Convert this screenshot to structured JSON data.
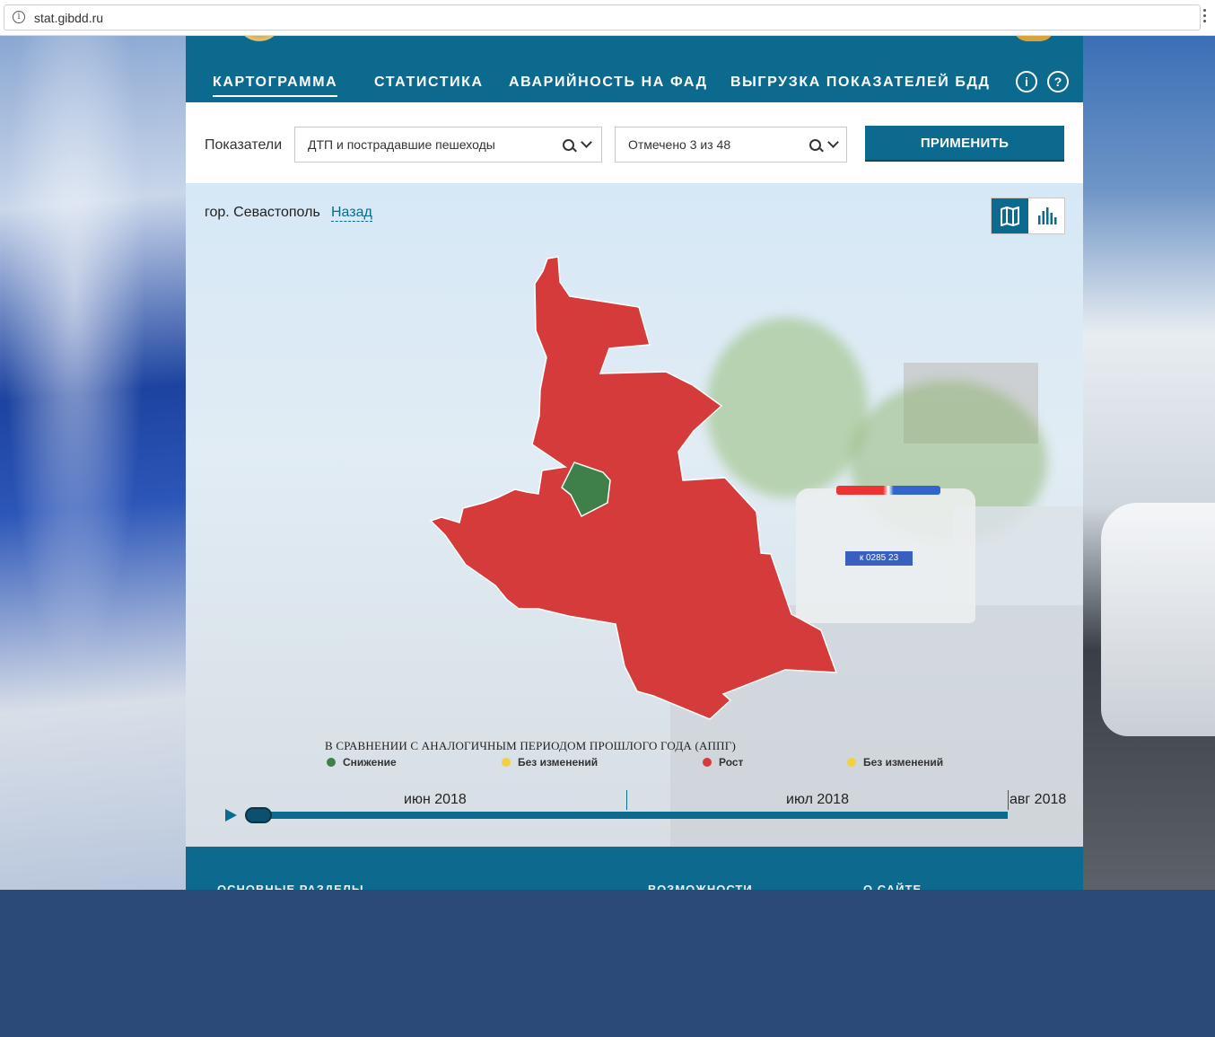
{
  "browser": {
    "url": "stat.gibdd.ru"
  },
  "nav": {
    "items": [
      {
        "label": "КАРТОГРАММА"
      },
      {
        "label": "СТАТИСТИКА"
      },
      {
        "label": "АВАРИЙНОСТЬ НА ФАД"
      },
      {
        "label": "ВЫГРУЗКА ПОКАЗАТЕЛЕЙ БДД"
      }
    ],
    "info_glyph": "i",
    "help_glyph": "?"
  },
  "filters": {
    "label": "Показатели",
    "indicator_value": "ДТП и пострадавшие пешеходы",
    "selected_value": "Отмечено 3 из 48",
    "apply_label": "ПРИМЕНИТЬ"
  },
  "map": {
    "location": "гор. Севастополь",
    "back_label": "Назад",
    "photo_plate": "к 0285 23",
    "regions": [
      {
        "name": "main-region",
        "status": "Рост",
        "color": "#d63b3b"
      },
      {
        "name": "small-region",
        "status": "Снижение",
        "color": "#3f7f4a"
      }
    ]
  },
  "legend": {
    "title": "В СРАВНЕНИИ С АНАЛОГИЧНЫМ ПЕРИОДОМ ПРОШЛОГО ГОДА (АППГ)",
    "items": [
      {
        "label": "Снижение",
        "color": "#3f7f4a"
      },
      {
        "label": "Без изменений",
        "color": "#f2d23c"
      },
      {
        "label": "Рост",
        "color": "#d63b3b"
      },
      {
        "label": "Без изменений",
        "color": "#f2d23c"
      }
    ]
  },
  "timeline": {
    "months": [
      "июн 2018",
      "июл 2018",
      "авг 2018"
    ]
  },
  "footer": {
    "headings": [
      "ОСНОВНЫЕ РАЗДЕЛЫ",
      "ВОЗМОЖНОСТИ",
      "О САЙТЕ"
    ]
  },
  "colors": {
    "brand": "#0c6a8e",
    "growth": "#d63b3b",
    "decrease": "#3f7f4a",
    "nochange": "#f2d23c"
  },
  "icons": [
    "info-icon",
    "search-icon",
    "chevron-down-icon",
    "map-view-icon",
    "bar-chart-view-icon",
    "play-icon"
  ]
}
